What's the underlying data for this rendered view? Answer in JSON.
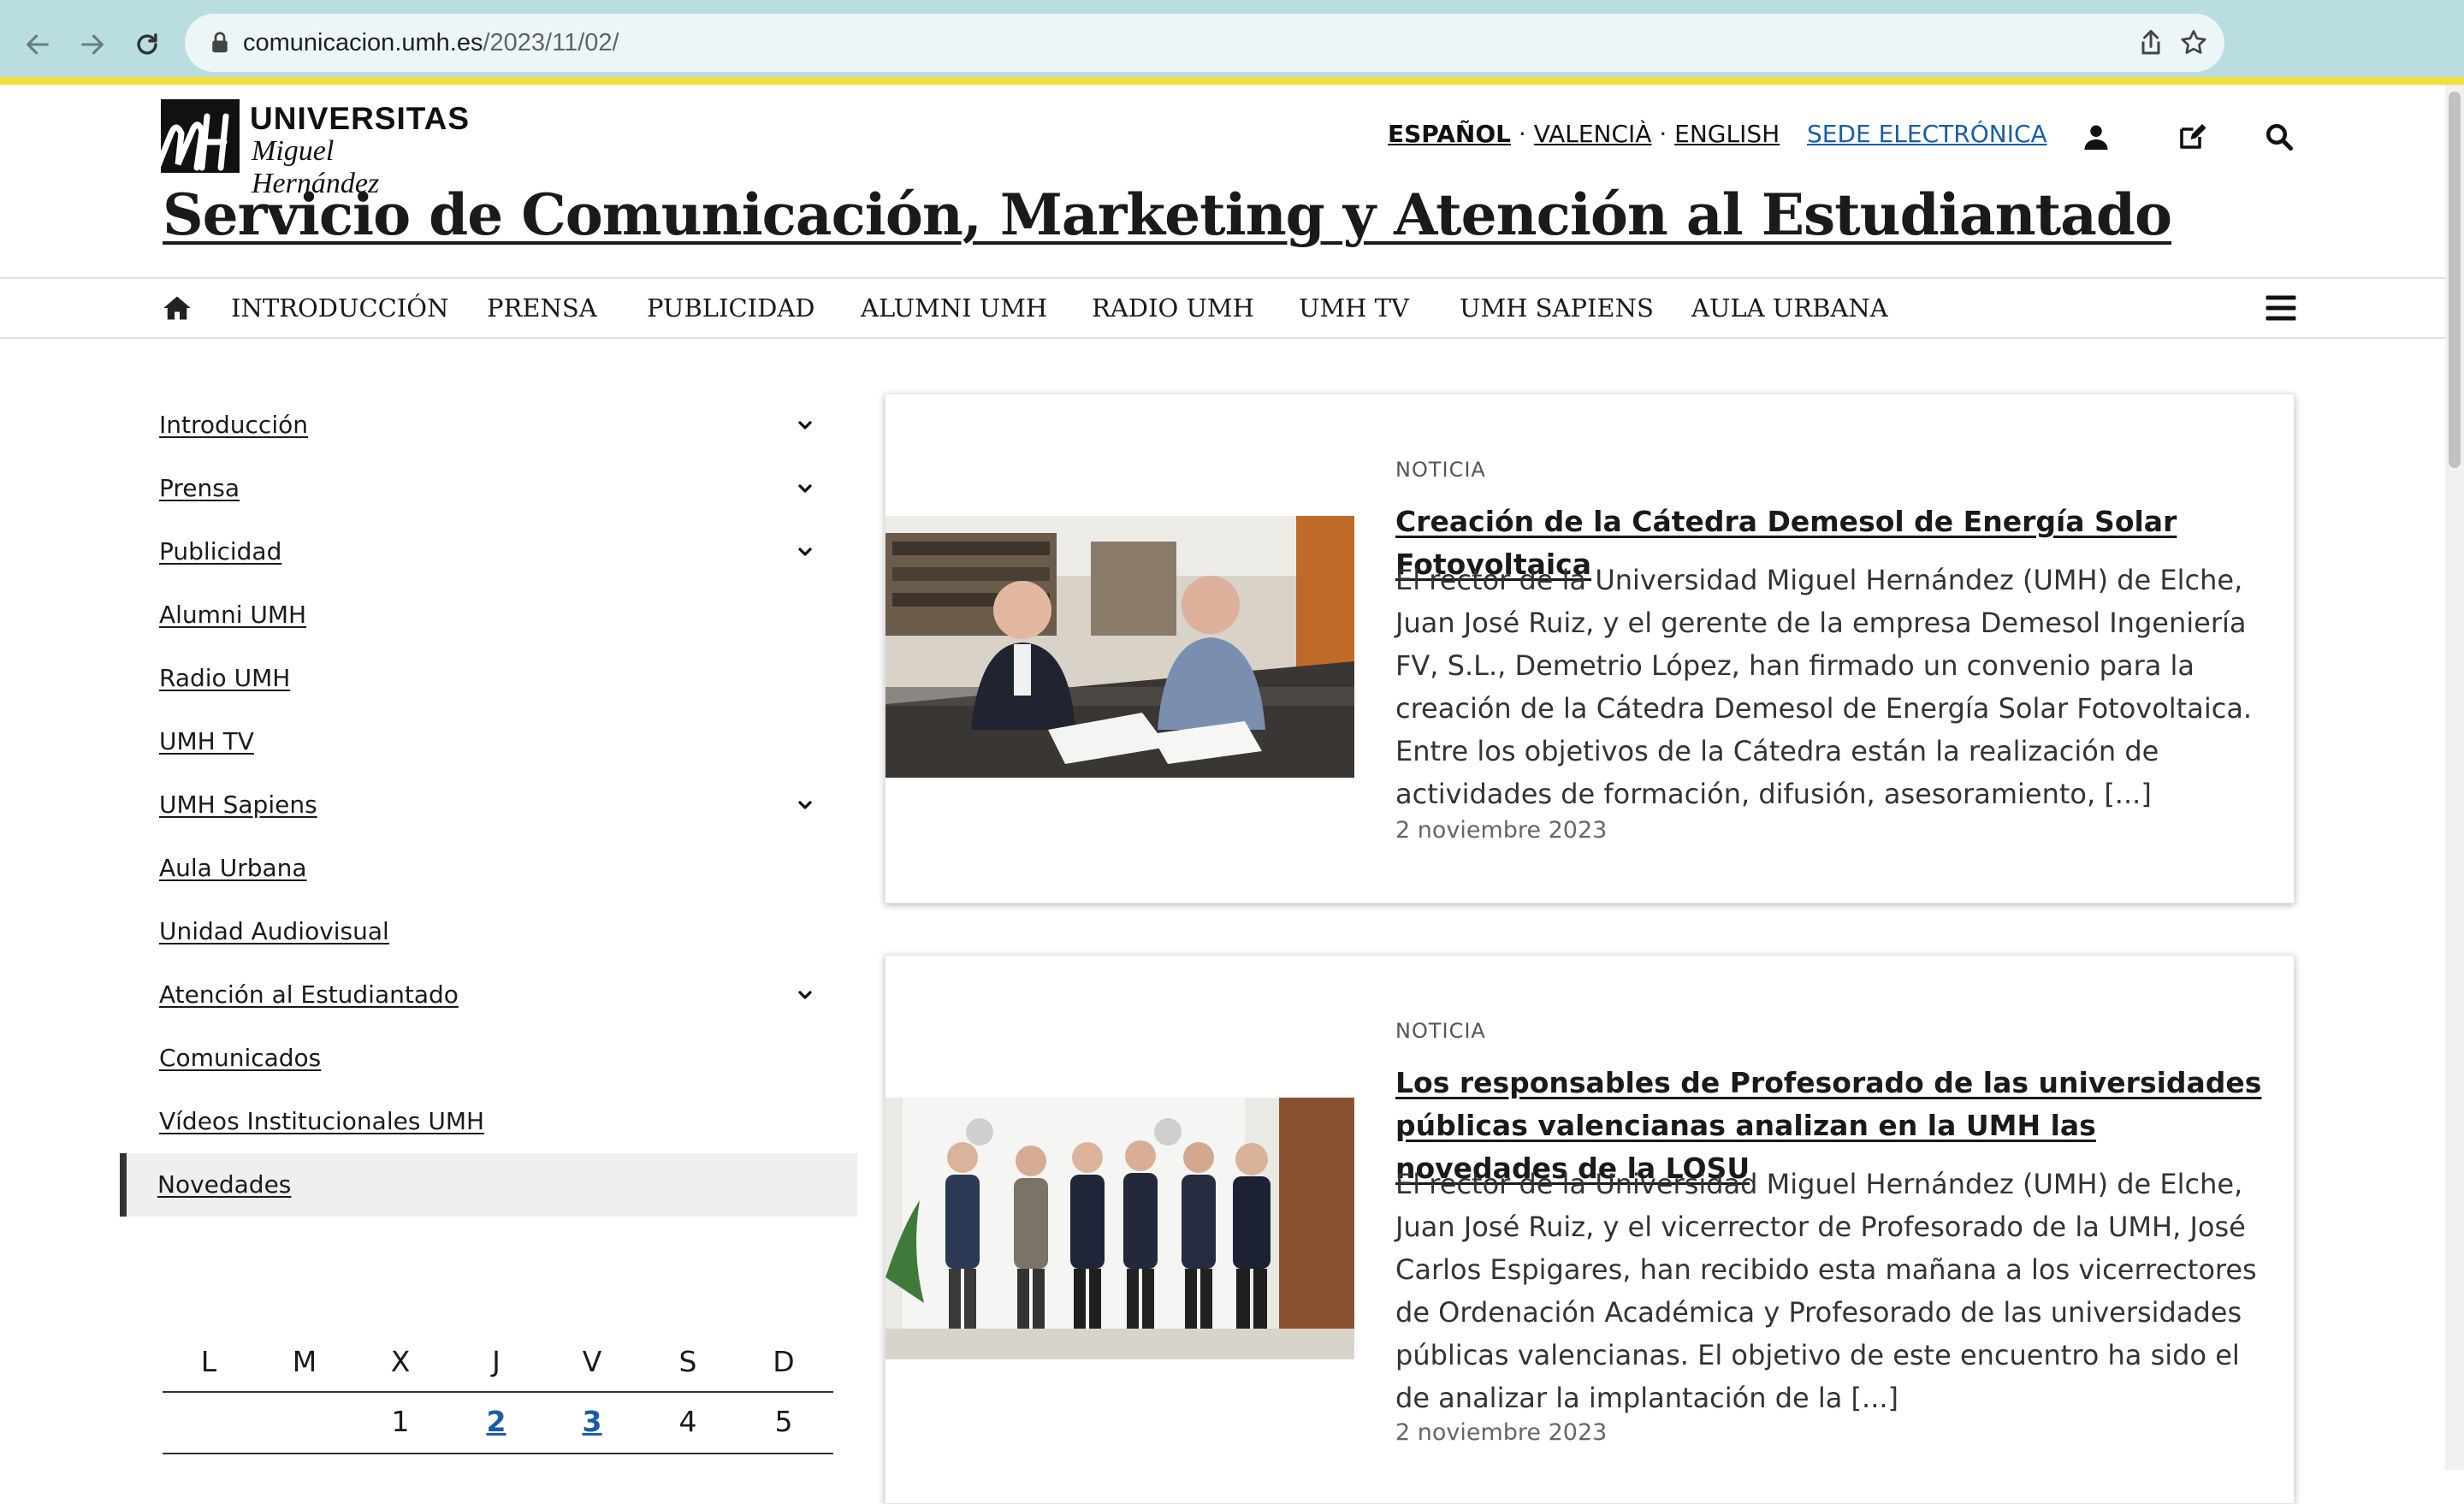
{
  "browser": {
    "url_host": "comunicacion.umh.es",
    "url_path": "/2023/11/02/"
  },
  "header": {
    "logo_line1": "UNIVERSITAS",
    "logo_line2": "Miguel Hernández",
    "languages": [
      "ESPAÑOL",
      "VALENCIÀ",
      "ENGLISH"
    ],
    "lang_separator": "·",
    "sede": "SEDE ELECTRÓNICA",
    "site_title": "Servicio de Comunicación, Marketing y Atención al Estudiantado"
  },
  "main_nav": [
    "INTRODUCCIÓN",
    "PRENSA",
    "PUBLICIDAD",
    "ALUMNI UMH",
    "RADIO UMH",
    "UMH TV",
    "UMH SAPIENS",
    "AULA URBANA"
  ],
  "sidebar": {
    "items": [
      {
        "label": "Introducción",
        "expandable": true
      },
      {
        "label": "Prensa",
        "expandable": true
      },
      {
        "label": "Publicidad",
        "expandable": true
      },
      {
        "label": "Alumni UMH",
        "expandable": false
      },
      {
        "label": "Radio UMH",
        "expandable": false
      },
      {
        "label": "UMH TV",
        "expandable": false
      },
      {
        "label": "UMH Sapiens",
        "expandable": true
      },
      {
        "label": "Aula Urbana",
        "expandable": false
      },
      {
        "label": "Unidad Audiovisual",
        "expandable": false
      },
      {
        "label": "Atención al Estudiantado",
        "expandable": true
      },
      {
        "label": "Comunicados",
        "expandable": false
      },
      {
        "label": "Vídeos Institucionales UMH",
        "expandable": false
      },
      {
        "label": "Novedades",
        "expandable": false,
        "active": true
      }
    ]
  },
  "calendar": {
    "headers": [
      "L",
      "M",
      "X",
      "J",
      "V",
      "S",
      "D"
    ],
    "days": [
      "1",
      "2",
      "3",
      "4",
      "5"
    ],
    "linked_days": [
      "2",
      "3"
    ]
  },
  "cards": [
    {
      "type": "NOTICIA",
      "title": "Creación de la Cátedra Demesol de Energía Solar Fotovoltaica",
      "body": "El rector de la Universidad Miguel Hernández (UMH) de Elche, Juan José Ruiz, y el gerente de la empresa Demesol Ingeniería FV, S.L., Demetrio López, han firmado un convenio para la creación de la Cátedra Demesol de Energía Solar Fotovoltaica. Entre los objetivos de la Cátedra están la realización de actividades de formación, difusión, asesoramiento, [...]",
      "date": "2 noviembre 2023"
    },
    {
      "type": "NOTICIA",
      "title": "Los responsables de Profesorado de las universidades públicas valencianas analizan en la UMH las novedades de la LOSU",
      "body": "El rector de la Universidad Miguel Hernández (UMH) de Elche, Juan José Ruiz, y el vicerrector de Profesorado de la UMH, José Carlos Espigares, han recibido esta mañana a los vicerrectores de Ordenación Académica y Profesorado de las universidades públicas valencianas. El objetivo de este encuentro ha sido el de analizar la implantación de la [...]",
      "date": "2 noviembre 2023"
    }
  ],
  "colors": {
    "browser_bar": "#b9dde0",
    "accent_strip": "#f2df38",
    "link_blue": "#1a5ca8"
  }
}
